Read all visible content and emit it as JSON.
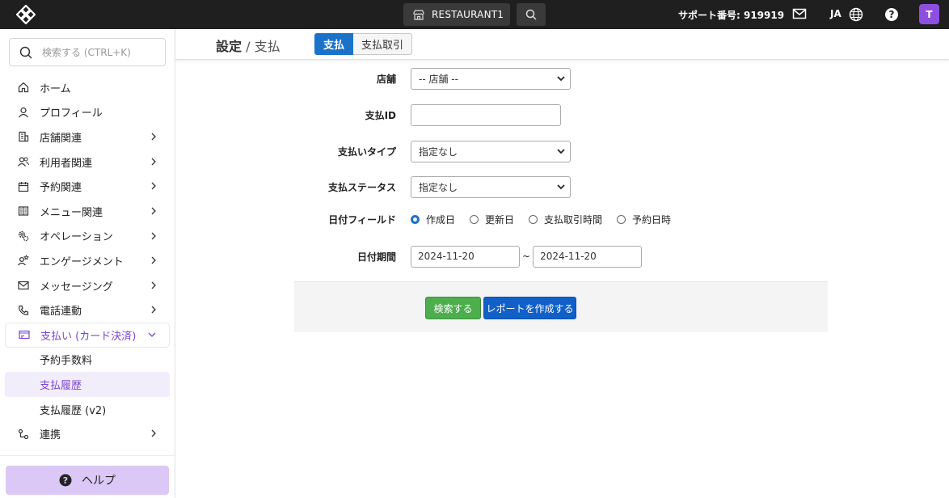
{
  "topbar": {
    "store_label": "RESTAURANT1",
    "support_text": "サポート番号: 919919",
    "lang_label": "JA",
    "avatar_initial": "T"
  },
  "sidebar": {
    "search_placeholder": "検索する (CTRL+K)",
    "items": [
      {
        "label": "ホーム",
        "icon": "home-icon"
      },
      {
        "label": "プロフィール",
        "icon": "user-icon"
      },
      {
        "label": "店舗関連",
        "icon": "building-icon"
      },
      {
        "label": "利用者関連",
        "icon": "users-icon"
      },
      {
        "label": "予約関連",
        "icon": "calendar-icon"
      },
      {
        "label": "メニュー関連",
        "icon": "book-icon"
      },
      {
        "label": "オペレーション",
        "icon": "gears-icon"
      },
      {
        "label": "エンゲージメント",
        "icon": "engagement-icon"
      },
      {
        "label": "メッセージング",
        "icon": "mail-icon"
      },
      {
        "label": "電話連動",
        "icon": "phone-icon"
      },
      {
        "label": "支払い (カード決済)",
        "icon": "payment-icon"
      },
      {
        "label": "連携",
        "icon": "link-icon"
      }
    ],
    "subitems": [
      "予約手数料",
      "支払履歴",
      "支払履歴 (v2)"
    ],
    "help_label": "ヘルプ"
  },
  "header": {
    "title_main": "設定",
    "title_sep": " / ",
    "title_sub": "支払",
    "tabs": [
      "支払",
      "支払取引"
    ]
  },
  "form": {
    "store_label": "店舗",
    "store_value": "-- 店舗 --",
    "payment_id_label": "支払ID",
    "payment_type_label": "支払いタイプ",
    "payment_type_value": "指定なし",
    "payment_status_label": "支払ステータス",
    "payment_status_value": "指定なし",
    "date_field_label": "日付フィールド",
    "date_field_options": [
      "作成日",
      "更新日",
      "支払取引時間",
      "予約日時"
    ],
    "date_range_label": "日付期間",
    "date_from": "2024-11-20",
    "date_to": "2024-11-20",
    "date_sep": "~"
  },
  "actions": {
    "search_label": "検索する",
    "report_label": "レポートを作成する"
  },
  "colors": {
    "accent": "#7a45d6",
    "primary": "#1a73c9",
    "success": "#4cae4c"
  }
}
